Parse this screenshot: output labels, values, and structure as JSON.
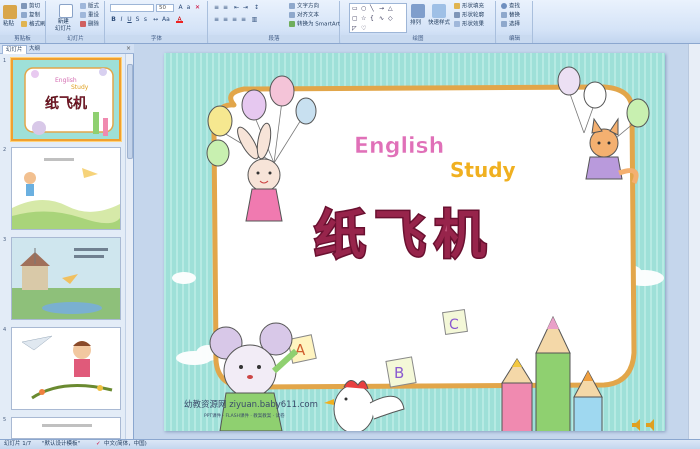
{
  "ribbon": {
    "clipboard": {
      "label": "剪贴板",
      "paste": "粘贴",
      "cut": "剪切",
      "copy": "复制",
      "format_painter": "格式刷"
    },
    "slides": {
      "label": "幻灯片",
      "new_slide": "新建\n幻灯片",
      "layout": "版式",
      "reset": "重设",
      "delete": "删除"
    },
    "font": {
      "label": "字体",
      "font_name": "",
      "font_size": "50"
    },
    "paragraph": {
      "label": "段落",
      "text_direction": "文字方向",
      "align_text": "对齐文本",
      "smartart": "转换为 SmartArt"
    },
    "drawing": {
      "label": "绘图",
      "arrange": "排列",
      "quick_styles": "快速样式",
      "shape_fill": "形状填充",
      "shape_outline": "形状轮廓",
      "shape_effects": "形状效果"
    },
    "editing": {
      "label": "编辑",
      "find": "查找",
      "replace": "替换",
      "select": "选择"
    }
  },
  "left_pane": {
    "tab_slides": "幻灯片",
    "tab_outline": "大纲",
    "close": "×",
    "slides": [
      {
        "number": "1",
        "selected": true
      },
      {
        "number": "2",
        "selected": false
      },
      {
        "number": "3",
        "selected": false
      },
      {
        "number": "4",
        "selected": false
      },
      {
        "number": "5",
        "selected": false
      }
    ]
  },
  "slide": {
    "english": "English",
    "study": "Study",
    "title": "纸飞机",
    "letters": [
      "A",
      "B",
      "C"
    ],
    "watermark": "幼教资源网 ziyuan.baby611.com",
    "watermark_sub": "PPT课件 · FLASH课件 · 教案教案 · 试卷"
  },
  "status_bar": {
    "slide_counter": "幻灯片 1/7",
    "theme": "\"默认设计模板\"",
    "language": "中文(简体，中国)"
  },
  "colors": {
    "slide_bg": "#9ee0d8",
    "frame_border": "#e2a64a",
    "title_fill": "#b0305a",
    "ribbon_bg": "#d4e3f7",
    "selected_thumb": "#f0a030"
  }
}
